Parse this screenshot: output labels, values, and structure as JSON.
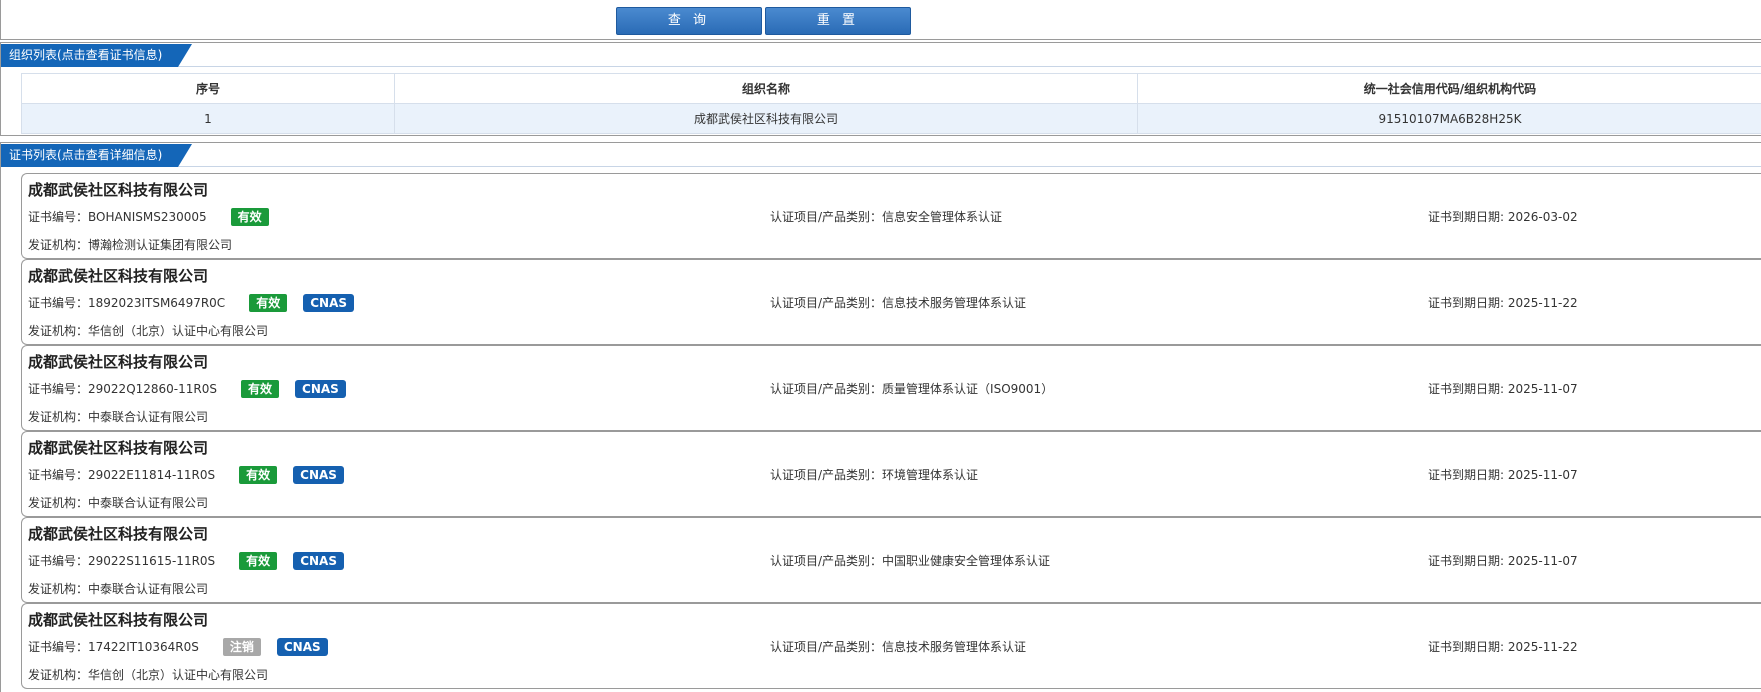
{
  "toolbar": {
    "query_label": "查 询",
    "reset_label": "重 置"
  },
  "org_section": {
    "title": "组织列表(点击查看证书信息)",
    "headers": [
      "序号",
      "组织名称",
      "统一社会信用代码/组织机构代码"
    ],
    "rows": [
      {
        "index": "1",
        "name": "成都武侯社区科技有限公司",
        "code": "91510107MA6B28H25K"
      }
    ]
  },
  "cert_section": {
    "title": "证书列表(点击查看详细信息)",
    "labels": {
      "cert_no": "证书编号：",
      "project": "认证项目/产品类别：",
      "expiry": "证书到期日期: ",
      "issuer": "发证机构："
    },
    "items": [
      {
        "company": "成都武侯社区科技有限公司",
        "cert_no": "BOHANISMS230005",
        "status": "有效",
        "status_type": "valid",
        "cnas": "",
        "project": "信息安全管理体系认证",
        "expiry": "2026-03-02",
        "issuer": "博瀚检测认证集团有限公司"
      },
      {
        "company": "成都武侯社区科技有限公司",
        "cert_no": "1892023ITSM6497R0C",
        "status": "有效",
        "status_type": "valid",
        "cnas": "CNAS",
        "project": "信息技术服务管理体系认证",
        "expiry": "2025-11-22",
        "issuer": "华信创（北京）认证中心有限公司"
      },
      {
        "company": "成都武侯社区科技有限公司",
        "cert_no": "29022Q12860-11R0S",
        "status": "有效",
        "status_type": "valid",
        "cnas": "CNAS",
        "project": "质量管理体系认证（ISO9001）",
        "expiry": "2025-11-07",
        "issuer": "中泰联合认证有限公司"
      },
      {
        "company": "成都武侯社区科技有限公司",
        "cert_no": "29022E11814-11R0S",
        "status": "有效",
        "status_type": "valid",
        "cnas": "CNAS",
        "project": "环境管理体系认证",
        "expiry": "2025-11-07",
        "issuer": "中泰联合认证有限公司"
      },
      {
        "company": "成都武侯社区科技有限公司",
        "cert_no": "29022S11615-11R0S",
        "status": "有效",
        "status_type": "valid",
        "cnas": "CNAS",
        "project": "中国职业健康安全管理体系认证",
        "expiry": "2025-11-07",
        "issuer": "中泰联合认证有限公司"
      },
      {
        "company": "成都武侯社区科技有限公司",
        "cert_no": "17422IT10364R0S",
        "status": "注销",
        "status_type": "cancelled",
        "cnas": "CNAS",
        "project": "信息技术服务管理体系认证",
        "expiry": "2025-11-22",
        "issuer": "华信创（北京）认证中心有限公司"
      }
    ]
  }
}
